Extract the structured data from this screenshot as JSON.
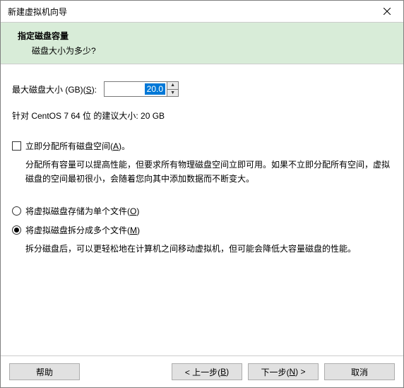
{
  "window": {
    "title": "新建虚拟机向导"
  },
  "header": {
    "title": "指定磁盘容量",
    "subtitle": "磁盘大小为多少?"
  },
  "disk": {
    "max_label_pre": "最大磁盘大小 (GB)(",
    "max_label_hot": "S",
    "max_label_post": "):",
    "value": "20.0",
    "recommend": "针对 CentOS 7 64 位 的建议大小: 20 GB"
  },
  "allocate": {
    "checkbox_label_pre": "立即分配所有磁盘空间(",
    "checkbox_label_hot": "A",
    "checkbox_label_post": ")。",
    "description": "分配所有容量可以提高性能，但要求所有物理磁盘空间立即可用。如果不立即分配所有空间，虚拟磁盘的空间最初很小，会随着您向其中添加数据而不断变大。"
  },
  "radios": {
    "single_pre": "将虚拟磁盘存储为单个文件(",
    "single_hot": "O",
    "single_post": ")",
    "split_pre": "将虚拟磁盘拆分成多个文件(",
    "split_hot": "M",
    "split_post": ")",
    "split_desc": "拆分磁盘后，可以更轻松地在计算机之间移动虚拟机，但可能会降低大容量磁盘的性能。"
  },
  "buttons": {
    "help": "帮助",
    "back_pre": "< 上一步(",
    "back_hot": "B",
    "back_post": ")",
    "next_pre": "下一步(",
    "next_hot": "N",
    "next_post": ") >",
    "cancel": "取消"
  }
}
